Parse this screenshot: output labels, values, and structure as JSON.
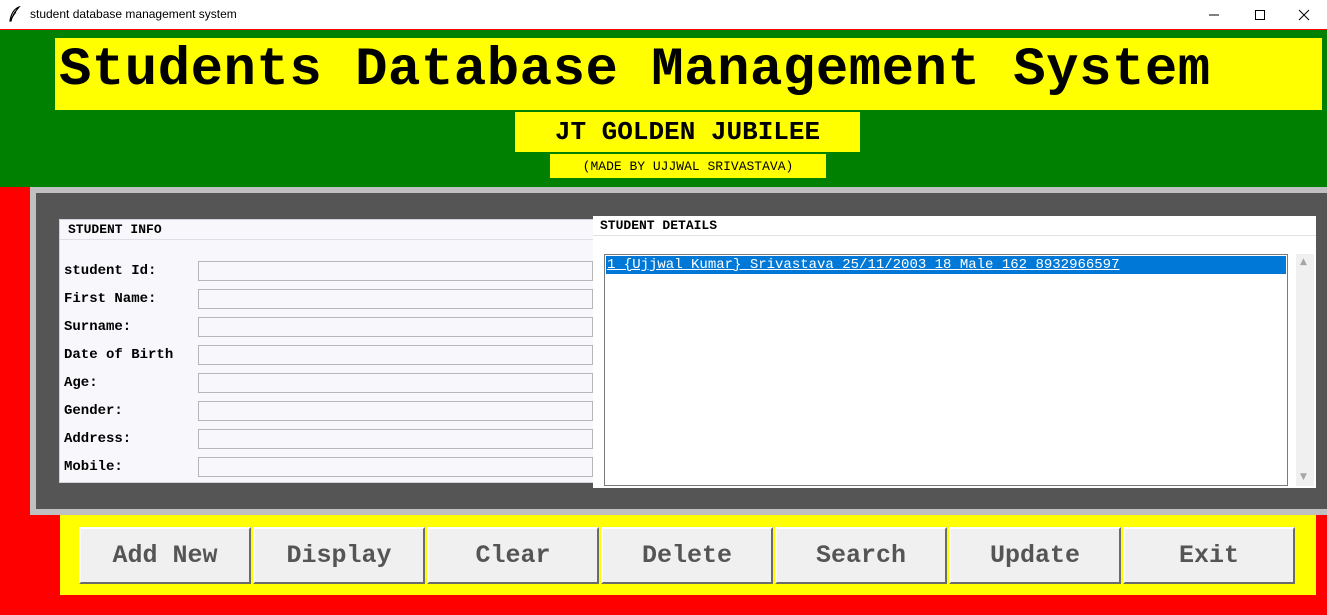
{
  "window": {
    "title": "student database management system",
    "controls": [
      "minimize",
      "maximize",
      "close"
    ]
  },
  "header": {
    "title": "Students Database Management System",
    "subtitle": "JT GOLDEN JUBILEE",
    "made_by": "(MADE BY UJJWAL SRIVASTAVA)"
  },
  "student_info": {
    "label": "STUDENT INFO",
    "fields": [
      {
        "label": "student Id:",
        "value": ""
      },
      {
        "label": "First Name:",
        "value": ""
      },
      {
        "label": "Surname:",
        "value": ""
      },
      {
        "label": "Date of Birth",
        "value": ""
      },
      {
        "label": "Age:",
        "value": ""
      },
      {
        "label": "Gender:",
        "value": ""
      },
      {
        "label": "Address:",
        "value": ""
      },
      {
        "label": "Mobile:",
        "value": ""
      }
    ]
  },
  "student_details": {
    "label": "STUDENT DETAILS",
    "records": [
      "1 {Ujjwal Kumar} Srivastava 25/11/2003 18 Male 162 8932966597"
    ]
  },
  "buttons": [
    "Add New",
    "Display",
    "Clear",
    "Delete",
    "Search",
    "Update",
    "Exit"
  ],
  "colors": {
    "background": "#ff0000",
    "header": "#008000",
    "highlight": "#ffff00",
    "selection": "#0078d7",
    "frame": "#555555"
  }
}
